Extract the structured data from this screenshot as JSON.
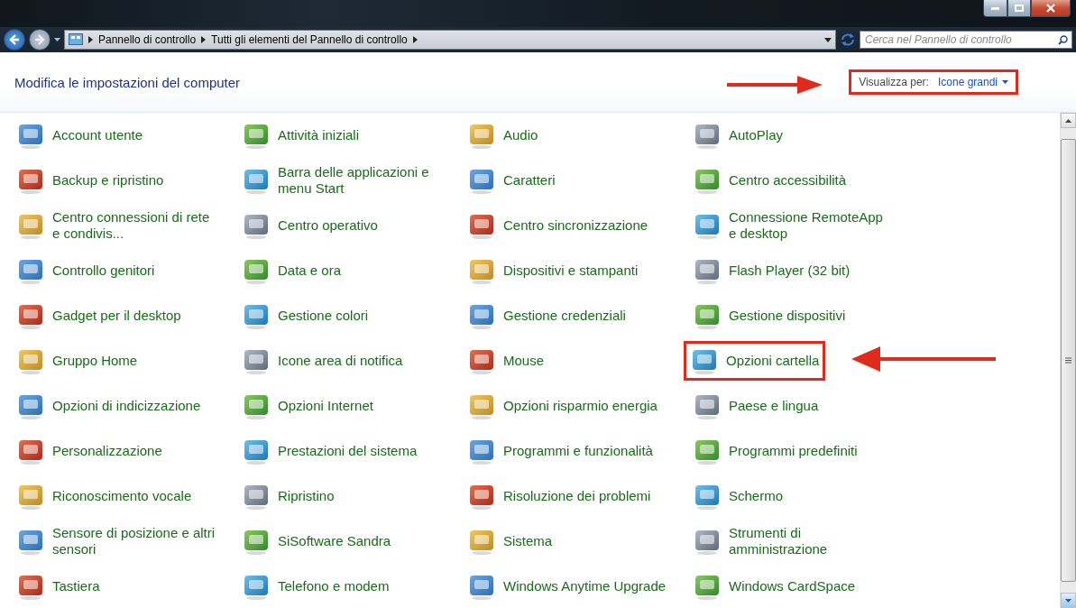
{
  "address_bar": {
    "breadcrumbs": [
      "Pannello di controllo",
      "Tutti gli elementi del Pannello di controllo"
    ]
  },
  "search": {
    "placeholder": "Cerca nel Pannello di controllo"
  },
  "header": {
    "title": "Modifica le impostazioni del computer",
    "view_label": "Visualizza per:",
    "view_value": "Icone grandi",
    "highlighted": true
  },
  "items": [
    {
      "label": "Account utente",
      "highlighted": false
    },
    {
      "label": "Attività iniziali",
      "highlighted": false
    },
    {
      "label": "Audio",
      "highlighted": false
    },
    {
      "label": "AutoPlay",
      "highlighted": false
    },
    {
      "label": "Backup e ripristino",
      "highlighted": false
    },
    {
      "label": "Barra delle applicazioni e menu Start",
      "highlighted": false
    },
    {
      "label": "Caratteri",
      "highlighted": false
    },
    {
      "label": "Centro accessibilità",
      "highlighted": false
    },
    {
      "label": "Centro connessioni di rete e condivis...",
      "highlighted": false
    },
    {
      "label": "Centro operativo",
      "highlighted": false
    },
    {
      "label": "Centro sincronizzazione",
      "highlighted": false
    },
    {
      "label": "Connessione RemoteApp e desktop",
      "highlighted": false
    },
    {
      "label": "Controllo genitori",
      "highlighted": false
    },
    {
      "label": "Data e ora",
      "highlighted": false
    },
    {
      "label": "Dispositivi e stampanti",
      "highlighted": false
    },
    {
      "label": "Flash Player (32 bit)",
      "highlighted": false
    },
    {
      "label": "Gadget per il desktop",
      "highlighted": false
    },
    {
      "label": "Gestione colori",
      "highlighted": false
    },
    {
      "label": "Gestione credenziali",
      "highlighted": false
    },
    {
      "label": "Gestione dispositivi",
      "highlighted": false
    },
    {
      "label": "Gruppo Home",
      "highlighted": false
    },
    {
      "label": "Icone area di notifica",
      "highlighted": false
    },
    {
      "label": "Mouse",
      "highlighted": false
    },
    {
      "label": "Opzioni cartella",
      "highlighted": true
    },
    {
      "label": "Opzioni di indicizzazione",
      "highlighted": false
    },
    {
      "label": "Opzioni Internet",
      "highlighted": false
    },
    {
      "label": "Opzioni risparmio energia",
      "highlighted": false
    },
    {
      "label": "Paese e lingua",
      "highlighted": false
    },
    {
      "label": "Personalizzazione",
      "highlighted": false
    },
    {
      "label": "Prestazioni del sistema",
      "highlighted": false
    },
    {
      "label": "Programmi e funzionalità",
      "highlighted": false
    },
    {
      "label": "Programmi predefiniti",
      "highlighted": false
    },
    {
      "label": "Riconoscimento vocale",
      "highlighted": false
    },
    {
      "label": "Ripristino",
      "highlighted": false
    },
    {
      "label": "Risoluzione dei problemi",
      "highlighted": false
    },
    {
      "label": "Schermo",
      "highlighted": false
    },
    {
      "label": "Sensore di posizione e altri sensori",
      "highlighted": false
    },
    {
      "label": "SiSoftware Sandra",
      "highlighted": false
    },
    {
      "label": "Sistema",
      "highlighted": false
    },
    {
      "label": "Strumenti di amministrazione",
      "highlighted": false
    },
    {
      "label": "Tastiera",
      "highlighted": false
    },
    {
      "label": "Telefono e modem",
      "highlighted": false
    },
    {
      "label": "Windows Anytime Upgrade",
      "highlighted": false
    },
    {
      "label": "Windows CardSpace",
      "highlighted": false
    }
  ]
}
